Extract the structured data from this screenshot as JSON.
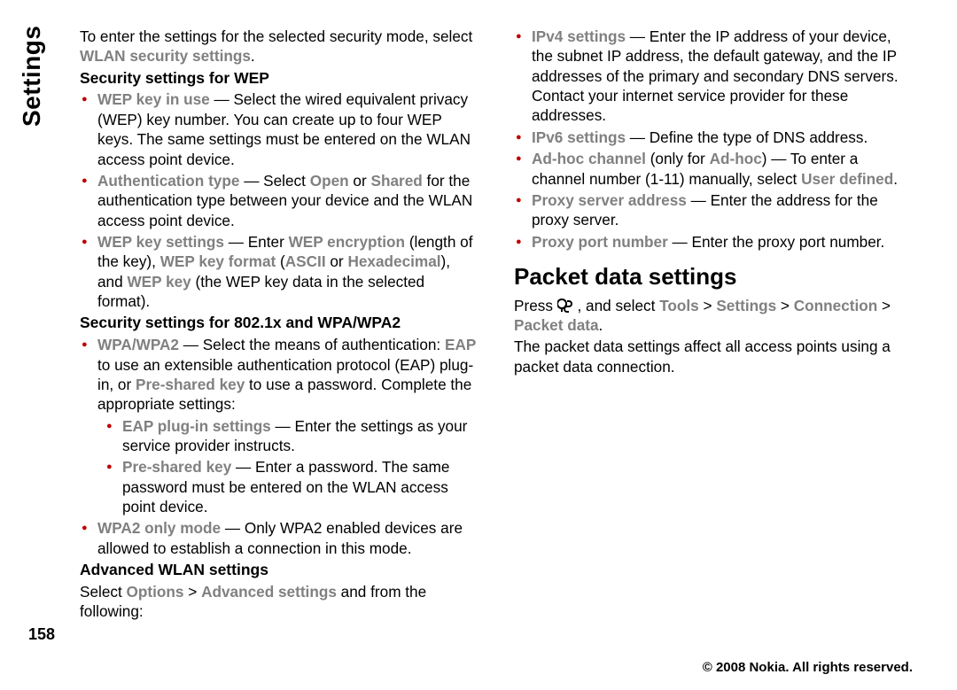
{
  "side_tab": "Settings",
  "page_number": "158",
  "intro": {
    "pre": "To enter the settings for the selected security mode, select ",
    "link": "WLAN security settings",
    "post": "."
  },
  "wep": {
    "heading": "Security settings for WEP",
    "items": [
      {
        "term": "WEP key in use",
        "text": " — Select the wired equivalent privacy (WEP) key number. You can create up to four WEP keys. The same settings must be entered on the WLAN access point device."
      },
      {
        "term": "Authentication type",
        "text_pre": " — Select ",
        "opt1": "Open",
        "mid": " or ",
        "opt2": "Shared",
        "text_post": " for the authentication type between your device and the WLAN access point device."
      },
      {
        "term": "WEP key settings",
        "text_pre": " — Enter ",
        "g1": "WEP encryption",
        "t1": " (length of the key), ",
        "g2": "WEP key format",
        "t2": " (",
        "g3": "ASCII",
        "t3": " or ",
        "g4": "Hexadecimal",
        "t4": "), and ",
        "g5": "WEP key",
        "t5": " (the WEP key data in the selected format)."
      }
    ]
  },
  "wpa": {
    "heading": "Security settings for 802.1x and WPA/WPA2",
    "main": {
      "term": "WPA/WPA2",
      "text_pre": " — Select the means of authentication: ",
      "g1": "EAP",
      "t1": " to use an extensible authentication protocol (EAP) plug-in, or ",
      "g2": "Pre-shared key",
      "t2": " to use a password. Complete the appropriate settings:"
    },
    "sub": [
      {
        "term": "EAP plug-in settings",
        "text": " — Enter the settings as your service provider instructs."
      },
      {
        "term": "Pre-shared key",
        "text": " — Enter a password. The same password must be entered on the WLAN access point device."
      }
    ],
    "wpa2only": {
      "term": "WPA2 only mode",
      "text": " — Only WPA2 enabled devices are allowed to establish a connection in this mode."
    }
  },
  "adv": {
    "heading": "Advanced WLAN settings",
    "lead_pre": "Select ",
    "lead_g1": "Options",
    "lead_sep": " > ",
    "lead_g2": "Advanced settings",
    "lead_post": " and from the following:",
    "items": {
      "ipv4": {
        "term": "IPv4 settings",
        "text": " — Enter the IP address of your device, the subnet IP address, the default gateway, and the IP addresses of the primary and secondary DNS servers. Contact your internet service provider for these addresses."
      },
      "ipv6": {
        "term": "IPv6 settings",
        "text": " — Define the type of DNS address."
      },
      "adhoc": {
        "term": "Ad-hoc channel",
        "pre": " (only for ",
        "g1": "Ad-hoc",
        "mid": ") — To enter a channel number (1-11) manually, select ",
        "g2": "User defined",
        "post": "."
      },
      "proxyaddr": {
        "term": "Proxy server address",
        "text": " — Enter the address for the proxy server."
      },
      "proxyport": {
        "term": "Proxy port number",
        "text": " — Enter the proxy port number."
      }
    }
  },
  "packet": {
    "heading": "Packet data settings",
    "press_pre": "Press ",
    "press_mid": " , and select ",
    "g1": "Tools",
    "sep": " > ",
    "g2": "Settings",
    "g3": "Connection",
    "g4": "Packet data",
    "post": ".",
    "desc": "The packet data settings affect all access points using a packet data connection."
  },
  "footer": "© 2008 Nokia. All rights reserved."
}
